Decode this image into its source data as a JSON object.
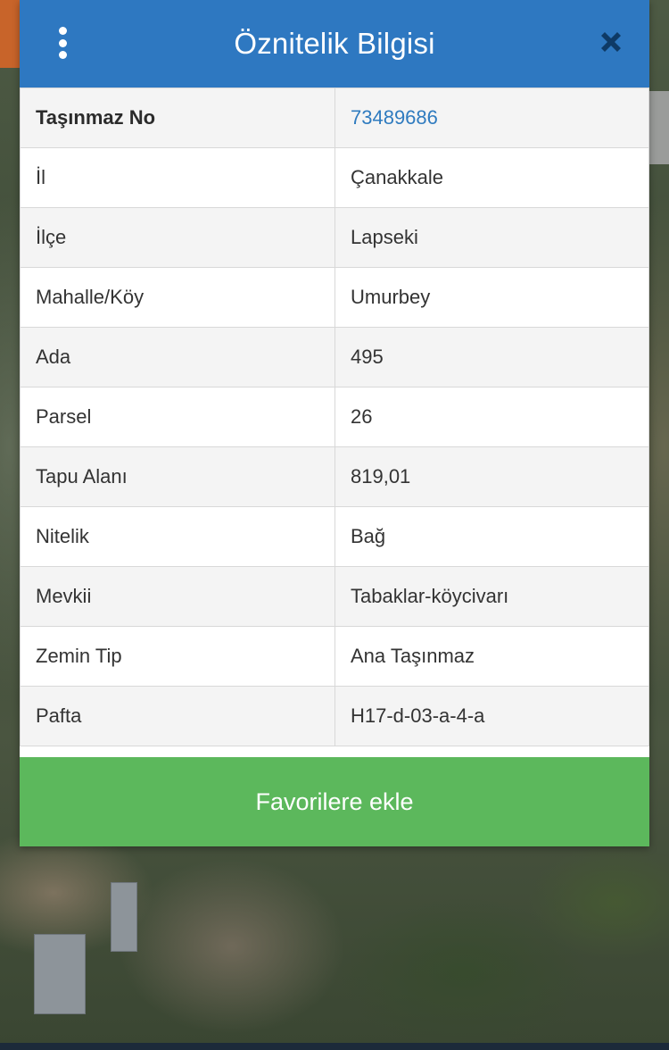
{
  "modal": {
    "title": "Öznitelik Bilgisi",
    "menu_icon": "vertical-ellipsis-icon",
    "close_icon": "close-icon",
    "header_color": "#2e78c1"
  },
  "attributes": [
    {
      "key": "Taşınmaz No",
      "value": "73489686"
    },
    {
      "key": "İl",
      "value": "Çanakkale"
    },
    {
      "key": "İlçe",
      "value": "Lapseki"
    },
    {
      "key": "Mahalle/Köy",
      "value": "Umurbey"
    },
    {
      "key": "Ada",
      "value": "495"
    },
    {
      "key": "Parsel",
      "value": "26"
    },
    {
      "key": "Tapu Alanı",
      "value": "819,01"
    },
    {
      "key": "Nitelik",
      "value": "Bağ"
    },
    {
      "key": "Mevkii",
      "value": "Tabaklar-köycivarı"
    },
    {
      "key": "Zemin Tip",
      "value": "Ana Taşınmaz"
    },
    {
      "key": "Pafta",
      "value": "H17-d-03-a-4-a"
    }
  ],
  "actions": {
    "favorite_label": "Favorilere ekle",
    "favorite_color": "#5cb85c"
  },
  "link_color": "#2f7bbf"
}
